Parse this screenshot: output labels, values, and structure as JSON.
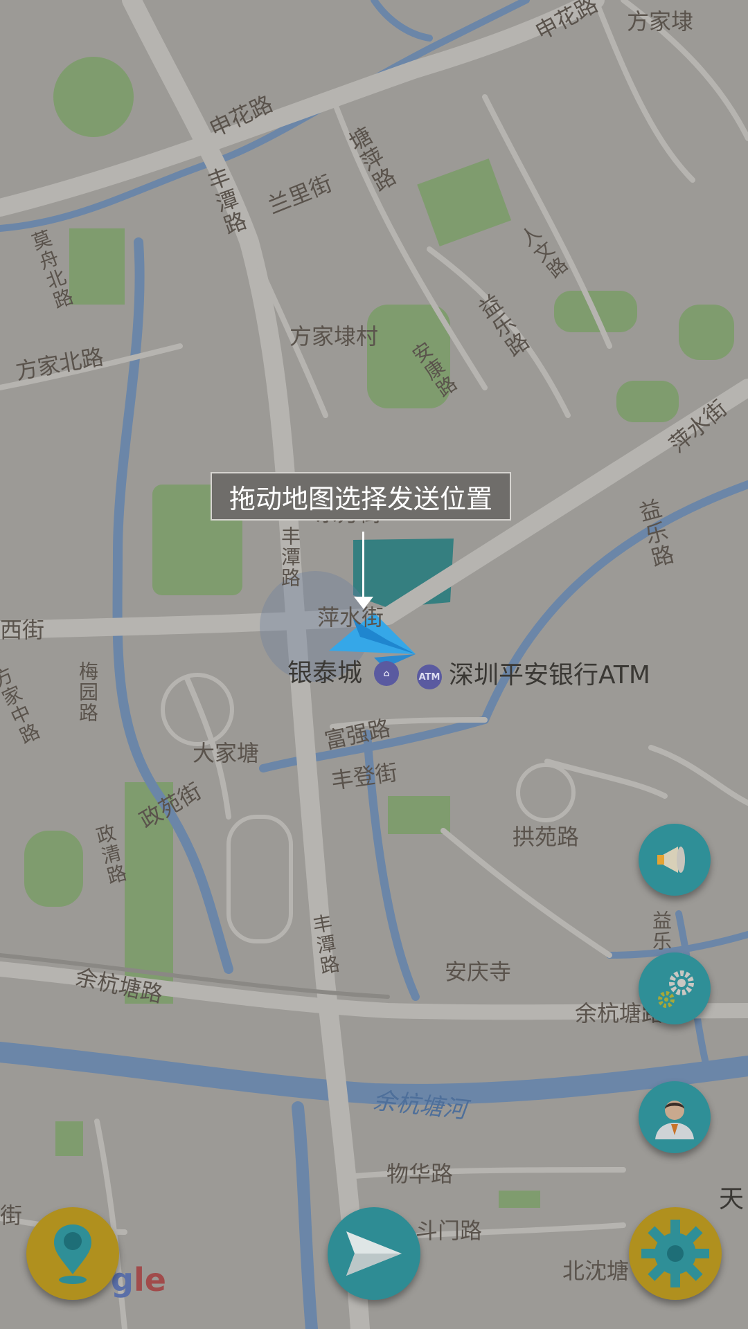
{
  "tooltip": {
    "text": "拖动地图选择发送位置"
  },
  "map": {
    "labels": {
      "shenhua_lu": "申花路",
      "fangjiadai_top": "方家埭",
      "shenhua_lu_top": "申花路",
      "tangping_lu": "塘萍路",
      "fengtan_lu_1": "丰潭路",
      "lanli_jie": "兰里街",
      "wenyi_lu": "人文路",
      "jingzhou_beilu": "莫舟北路",
      "yile_lu_1": "益乐路",
      "fangjiadai_cun": "方家埭村",
      "ankang_lu": "安康路",
      "fangjia_beilu": "方家北路",
      "pingshui_jie_right": "萍水街",
      "yile_lu_2": "益乐路",
      "dongfang_jie": "东方街",
      "fengtan_lu_2": "丰潭路",
      "pingshui_jie_center": "萍水街",
      "xi_jie": "西街",
      "yintaicheng": "银泰城",
      "pingan_atm": "深圳平安银行ATM",
      "fangjia_zhonglu": "方家中路",
      "meiyuan_lu": "梅园路",
      "dajiatang": "大家塘",
      "fuqiang_lu": "富强路",
      "fengdeng_jie": "丰登街",
      "zhengyuan_jie": "政苑街",
      "gongyuan_lu": "拱苑路",
      "zhengqing_lu": "政清路",
      "yile_lu_3": "益乐",
      "fengtan_lu_3": "丰潭路",
      "anqing_si": "安庆寺",
      "yuhangtang_lu_left": "余杭塘路",
      "yuhangtang_lu_right": "余杭塘路",
      "yuhangtang_he": "余杭塘河",
      "wuhua_lu": "物华路",
      "doumen_lu": "斗门路",
      "tian": "天",
      "jie_left": "街",
      "beishen": "北沈塘"
    },
    "atm_icon": "ATM",
    "google_logo_g": "g",
    "google_logo_rest": "le"
  },
  "buttons": {
    "broadcast": "megaphone-icon",
    "settings": "gears-icon",
    "profile": "person-icon",
    "location": "map-pin-icon",
    "send": "paper-plane-icon",
    "options": "cog-icon"
  },
  "colors": {
    "map_bg": "#9c9a96",
    "road": "#b6b4b0",
    "park": "#7f9c6e",
    "water": "#6b86a8",
    "accent_teal": "#2f8f97",
    "accent_gold": "#b0901e",
    "plane": "#35a7e8"
  }
}
